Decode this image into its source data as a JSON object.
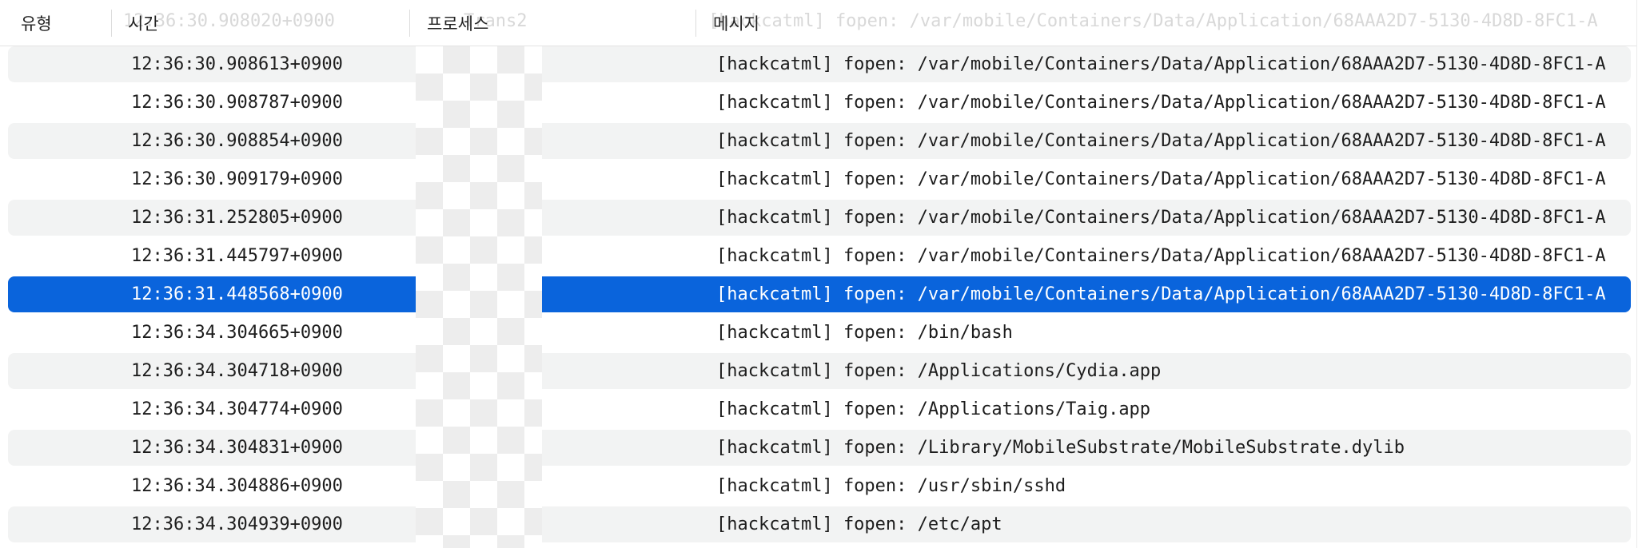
{
  "header": {
    "columns": [
      "유형",
      "시간",
      "프로세스",
      "메시지"
    ],
    "ghost_time": "12:36:30.908020+0900",
    "ghost_process": "Trans2",
    "ghost_message": "[hackcatml] fopen: /var/mobile/Containers/Data/Application/68AAA2D7-5130-4D8D-8FC1-A"
  },
  "rows": [
    {
      "time": "12:36:30.908613+0900",
      "message": "[hackcatml] fopen: /var/mobile/Containers/Data/Application/68AAA2D7-5130-4D8D-8FC1-A",
      "selected": false
    },
    {
      "time": "12:36:30.908787+0900",
      "message": "[hackcatml] fopen: /var/mobile/Containers/Data/Application/68AAA2D7-5130-4D8D-8FC1-A",
      "selected": false
    },
    {
      "time": "12:36:30.908854+0900",
      "message": "[hackcatml] fopen: /var/mobile/Containers/Data/Application/68AAA2D7-5130-4D8D-8FC1-A",
      "selected": false
    },
    {
      "time": "12:36:30.909179+0900",
      "message": "[hackcatml] fopen: /var/mobile/Containers/Data/Application/68AAA2D7-5130-4D8D-8FC1-A",
      "selected": false
    },
    {
      "time": "12:36:31.252805+0900",
      "message": "[hackcatml] fopen: /var/mobile/Containers/Data/Application/68AAA2D7-5130-4D8D-8FC1-A",
      "selected": false
    },
    {
      "time": "12:36:31.445797+0900",
      "message": "[hackcatml] fopen: /var/mobile/Containers/Data/Application/68AAA2D7-5130-4D8D-8FC1-A",
      "selected": false
    },
    {
      "time": "12:36:31.448568+0900",
      "message": "[hackcatml] fopen: /var/mobile/Containers/Data/Application/68AAA2D7-5130-4D8D-8FC1-A",
      "selected": true
    },
    {
      "time": "12:36:34.304665+0900",
      "message": "[hackcatml] fopen: /bin/bash",
      "selected": false
    },
    {
      "time": "12:36:34.304718+0900",
      "message": "[hackcatml] fopen: /Applications/Cydia.app",
      "selected": false
    },
    {
      "time": "12:36:34.304774+0900",
      "message": "[hackcatml] fopen: /Applications/Taig.app",
      "selected": false
    },
    {
      "time": "12:36:34.304831+0900",
      "message": "[hackcatml] fopen: /Library/MobileSubstrate/MobileSubstrate.dylib",
      "selected": false
    },
    {
      "time": "12:36:34.304886+0900",
      "message": "[hackcatml] fopen: /usr/sbin/sshd",
      "selected": false
    },
    {
      "time": "12:36:34.304939+0900",
      "message": "[hackcatml] fopen: /etc/apt",
      "selected": false
    }
  ]
}
